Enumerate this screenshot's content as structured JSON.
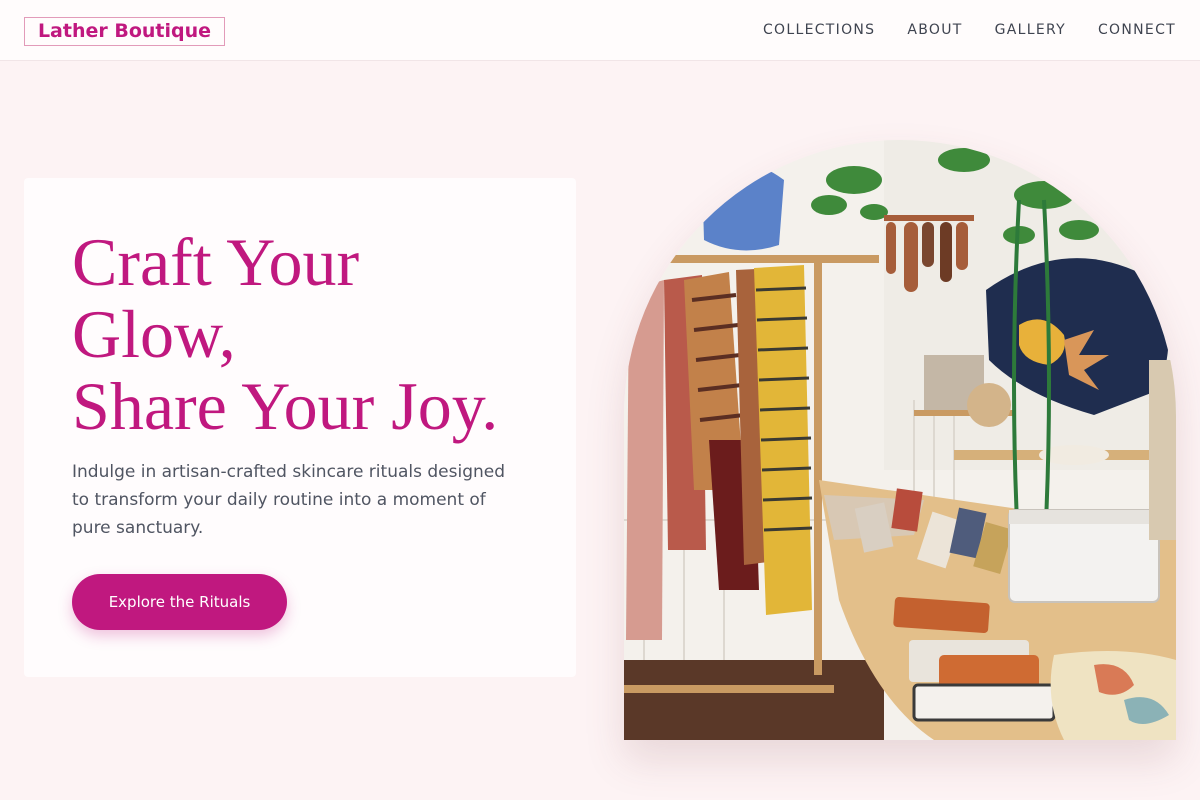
{
  "brand": {
    "name": "Lather Boutique",
    "color": "#c0187f"
  },
  "nav": {
    "items": [
      {
        "label": "COLLECTIONS"
      },
      {
        "label": "ABOUT"
      },
      {
        "label": "GALLERY"
      },
      {
        "label": "CONNECT"
      }
    ]
  },
  "hero": {
    "headline_lines": [
      "Craft Your",
      "Glow,",
      "Share Your Joy."
    ],
    "description": "Indulge in artisan-crafted skincare rituals designed to transform your daily routine into a moment of pure sanctuary.",
    "cta_label": "Explore the Rituals"
  },
  "colors": {
    "accent": "#c0187f",
    "page_bg": "#fdf3f4",
    "card_bg": "#fffcfd",
    "nav_text": "#3f4450",
    "body_text": "#505562"
  },
  "image": {
    "subject": "boutique-interior-photo"
  }
}
